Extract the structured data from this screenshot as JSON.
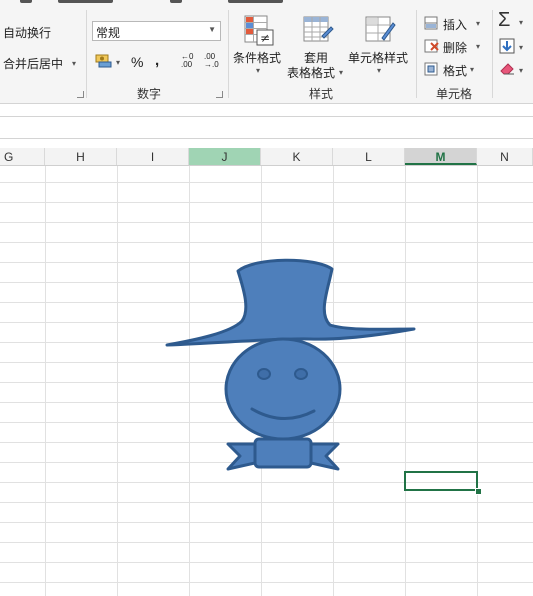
{
  "ribbon": {
    "alignment": {
      "wrap_text": "自动换行",
      "merge_center": "合并后居中"
    },
    "number": {
      "format_value": "常规",
      "percent_symbol": "%",
      "comma_symbol": ",",
      "increase_decimal_top": "←0",
      "increase_decimal_bottom": ".00",
      "decrease_decimal_top": ".00",
      "decrease_decimal_bottom": "→.0",
      "group_label": "数字"
    },
    "styles": {
      "conditional_formatting": "条件格式",
      "format_as_table_line1": "套用",
      "format_as_table_line2": "表格格式",
      "cell_styles": "单元格样式",
      "group_label": "样式"
    },
    "cells": {
      "insert": "插入",
      "delete": "删除",
      "format": "格式",
      "group_label": "单元格"
    },
    "editing": {
      "autosum_icon": "sigma-icon",
      "fill_icon": "fill-down-icon",
      "clear_icon": "eraser-icon"
    }
  },
  "sheet": {
    "columns": [
      "G",
      "H",
      "I",
      "J",
      "K",
      "L",
      "M",
      "N"
    ],
    "selected_column": "J",
    "active_column": "M"
  },
  "colors": {
    "accent_green": "#217346",
    "selected_header": "#a0d4b4",
    "shape_fill": "#4e7fbb",
    "shape_stroke": "#2e5a8e"
  },
  "shape": {
    "icon": "hat-man-drawing"
  }
}
